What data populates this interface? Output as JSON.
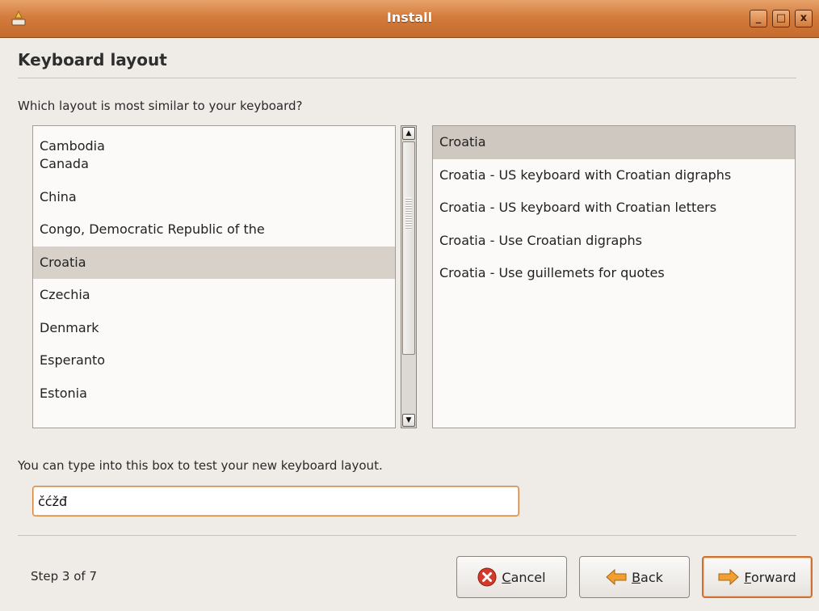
{
  "window": {
    "title": "Install",
    "icon": "installer-icon",
    "controls": [
      "minimize-icon",
      "maximize-icon",
      "close-icon"
    ],
    "minimize_glyph": "_",
    "maximize_glyph": "□",
    "close_glyph": "x"
  },
  "page": {
    "heading": "Keyboard layout",
    "question": "Which layout is most similar to your keyboard?",
    "hint": "You can type into this box to test your new keyboard layout."
  },
  "layouts": {
    "selected": "Croatia",
    "items": [
      "Cambodia",
      "Canada",
      "China",
      "Congo, Democratic Republic of the",
      "Croatia",
      "Czechia",
      "Denmark",
      "Esperanto",
      "Estonia"
    ]
  },
  "variants": {
    "selected": "Croatia",
    "items": [
      "Croatia",
      "Croatia - US keyboard with Croatian digraphs",
      "Croatia - US keyboard with Croatian letters",
      "Croatia - Use Croatian digraphs",
      "Croatia - Use guillemets for quotes"
    ]
  },
  "test_box": {
    "value": "čćžđ"
  },
  "footer": {
    "step": "Step 3 of 7",
    "cancel_mnemonic": "C",
    "cancel_rest": "ancel",
    "back_mnemonic": "B",
    "back_rest": "ack",
    "forward_mnemonic": "F",
    "forward_rest": "orward"
  },
  "colors": {
    "titlebar": "#d47c3d",
    "selection": "#d7d1ca",
    "cancel_icon": "#d33a2c",
    "arrow_icon": "#f0a030"
  }
}
